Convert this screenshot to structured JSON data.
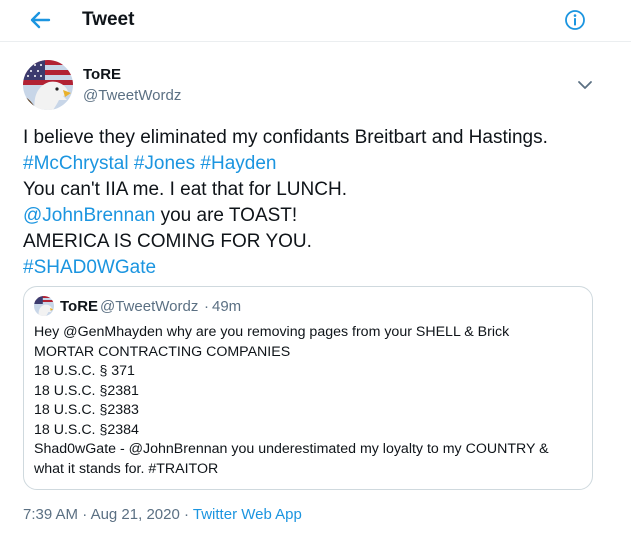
{
  "header": {
    "title": "Tweet"
  },
  "author": {
    "name": "ToRE",
    "handle": "@TweetWordz"
  },
  "tweet": {
    "line1": "I believe they eliminated my confidants Breitbart and Hastings.",
    "hashtags1": [
      "#McChrystal",
      "#Jones",
      "#Hayden"
    ],
    "line3": "You can't IIA me.  I eat that for LUNCH.",
    "mention": "@JohnBrennan",
    "line4_rest": " you are TOAST!",
    "line5": "AMERICA IS COMING FOR YOU.",
    "hashtag_last": "#SHAD0WGate"
  },
  "quote": {
    "name": "ToRE",
    "handle": "@TweetWordz",
    "separator": "·",
    "time": "49m",
    "lines": [
      "Hey @GenMhayden why are you removing pages from your SHELL & Brick",
      "MORTAR CONTRACTING COMPANIES",
      "18 U.S.C. § 371",
      "18 U.S.C. §2381",
      "18 U.S.C. §2383",
      "18 U.S.C. §2384",
      "Shad0wGate -  @JohnBrennan you underestimated my loyalty to my COUNTRY &",
      "what it stands for. #TRAITOR"
    ]
  },
  "meta": {
    "time": "7:39 AM",
    "date": "Aug 21, 2020",
    "separator": "·",
    "app": "Twitter Web App"
  },
  "colors": {
    "accent": "#1b95e0",
    "secondary_text": "#5b7083",
    "border": "#cfd9de"
  },
  "icons": {
    "back": "arrow-left-icon",
    "info": "info-circle-icon",
    "more": "chevron-down-icon"
  }
}
